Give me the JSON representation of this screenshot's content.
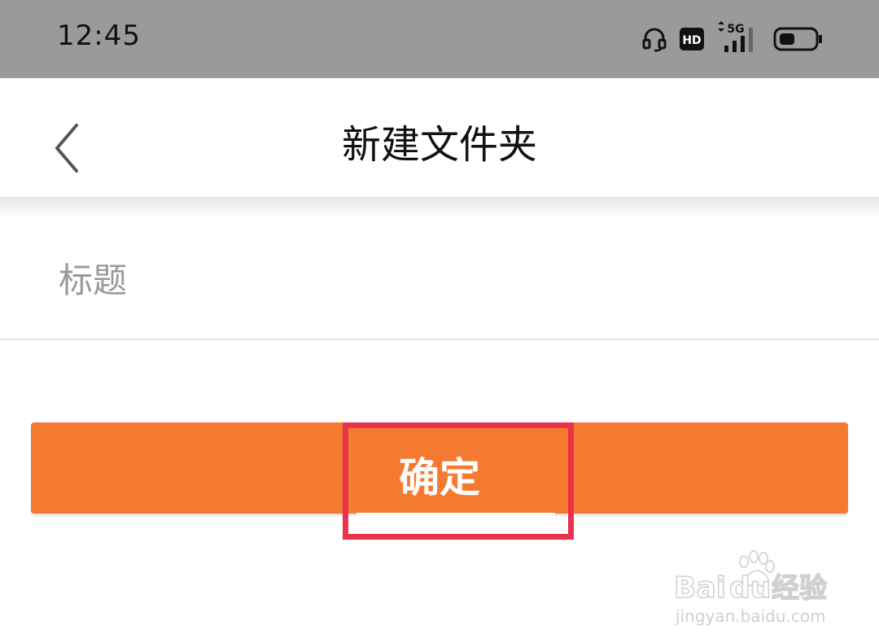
{
  "status_bar": {
    "time": "12:45",
    "icons": [
      "headset-icon",
      "hd-icon",
      "5g-signal-icon",
      "battery-icon"
    ],
    "hd_label": "HD",
    "network_label": "5G"
  },
  "nav": {
    "back_icon": "chevron-left-icon",
    "title": "新建文件夹"
  },
  "form": {
    "title_placeholder": "标题",
    "title_value": ""
  },
  "actions": {
    "confirm_label": "确定"
  },
  "watermark": {
    "brand": "Bai du 经验",
    "url": "jingyan.baidu.com"
  },
  "colors": {
    "status_bar": "#9a9a9a",
    "accent": "#f57a31",
    "highlight": "#e8334a"
  }
}
